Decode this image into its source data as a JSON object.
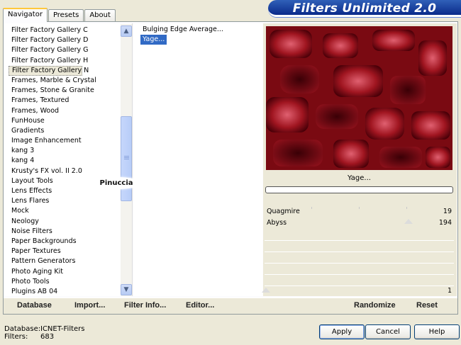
{
  "tabs": [
    "Navigator",
    "Presets",
    "About"
  ],
  "banner_title": "Filters Unlimited 2.0",
  "categories": [
    "Filter Factory Gallery C",
    "Filter Factory Gallery D",
    "Filter Factory Gallery G",
    "Filter Factory Gallery H",
    "Filter Factory Gallery N",
    "Frames, Marble & Crystal",
    "Frames, Stone & Granite",
    "Frames, Textured",
    "Frames, Wood",
    "FunHouse",
    "Gradients",
    "Image Enhancement",
    "kang 3",
    "kang 4",
    "Krusty's FX vol. II 2.0",
    "Layout Tools",
    "Lens Effects",
    "Lens Flares",
    "Mock",
    "Neology",
    "Noise Filters",
    "Paper Backgrounds",
    "Paper Textures",
    "Pattern Generators",
    "Photo Aging Kit",
    "Photo Tools",
    "Plugins AB 04"
  ],
  "selected_category": "Filter Factory Gallery N",
  "filters": [
    "Bulging Edge Average...",
    "Yage..."
  ],
  "selected_filter": "Yage...",
  "preview_label": "Yage...",
  "watermark": "Pinuccia",
  "params": [
    {
      "label": "Quagmire",
      "value": "19"
    },
    {
      "label": "Abyss",
      "value": "194"
    }
  ],
  "extra_slider_value": "1",
  "bottom_buttons": {
    "database": "Database",
    "import": "Import...",
    "filter_info": "Filter Info...",
    "editor": "Editor...",
    "randomize": "Randomize",
    "reset": "Reset"
  },
  "db_info": {
    "database_label": "Database:",
    "database_value": "ICNET-Filters",
    "filters_label": "Filters:",
    "filters_value": "683"
  },
  "dialog_buttons": {
    "apply": "Apply",
    "cancel": "Cancel",
    "help": "Help"
  },
  "colors": {
    "selection": "#316ac5",
    "banner": "#0a2a8a",
    "preview": "#7a0a12"
  }
}
